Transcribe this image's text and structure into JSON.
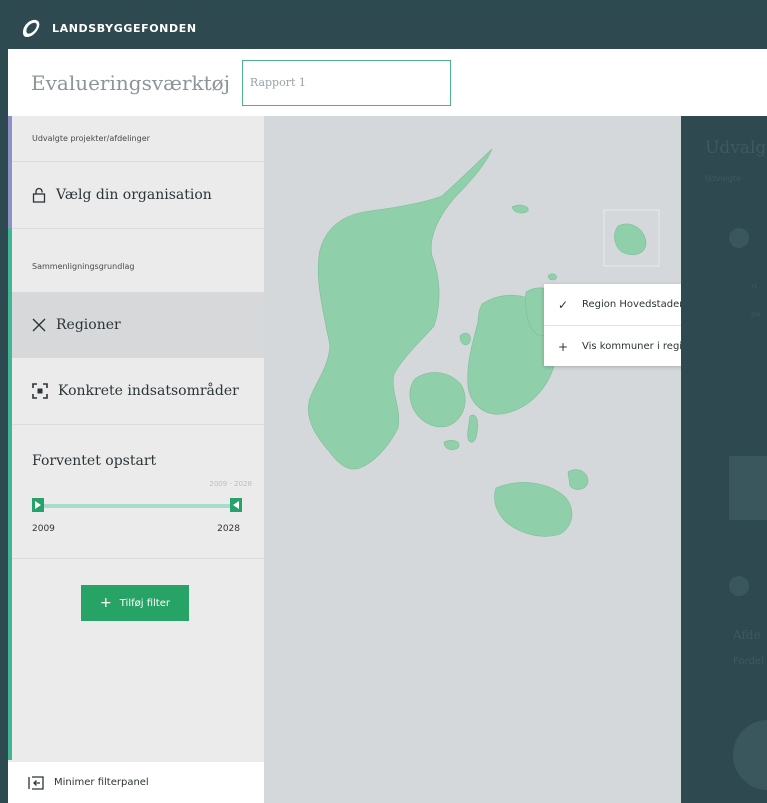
{
  "brand": {
    "name": "LANDSBYGGEFONDEN",
    "logo_icon": "landsbyggefonden-logo-icon"
  },
  "toolbar": {
    "title": "Evalueringsværktøj",
    "report_name": "Rapport 1"
  },
  "sidebar": {
    "selected_caption": "Udvalgte projekter/afdelinger",
    "organisation_label": "Vælg din organisation",
    "basis_caption": "Sammenligningsgrundlag",
    "regioner_label": "Regioner",
    "konkrete_label": "Konkrete indsatsområder",
    "opstart": {
      "title": "Forventet opstart",
      "range_label": "2009 - 2028",
      "min_label": "2009",
      "max_label": "2028",
      "min_value": 2009,
      "max_value": 2028
    },
    "add_filter_label": "Tilføj filter",
    "minimize_label": "Minimer filterpanel"
  },
  "map": {
    "context_menu": {
      "items": [
        {
          "label": "Region Hovedstaden",
          "icon": "check-icon"
        },
        {
          "label": "Vis kommuner i regionen",
          "icon": "plus-icon"
        }
      ]
    },
    "land_color": "#8fcfaa"
  },
  "right_panel": {
    "title": "Udvalg",
    "sub": "Udvalgte",
    "small_a": "ri",
    "small_b": "ov",
    "title2": "Afde",
    "sub2": "Fordel"
  },
  "colors": {
    "accent_green": "#27a465",
    "dark_bg": "#2e4a50",
    "accent_purple": "#8f8fc9"
  }
}
